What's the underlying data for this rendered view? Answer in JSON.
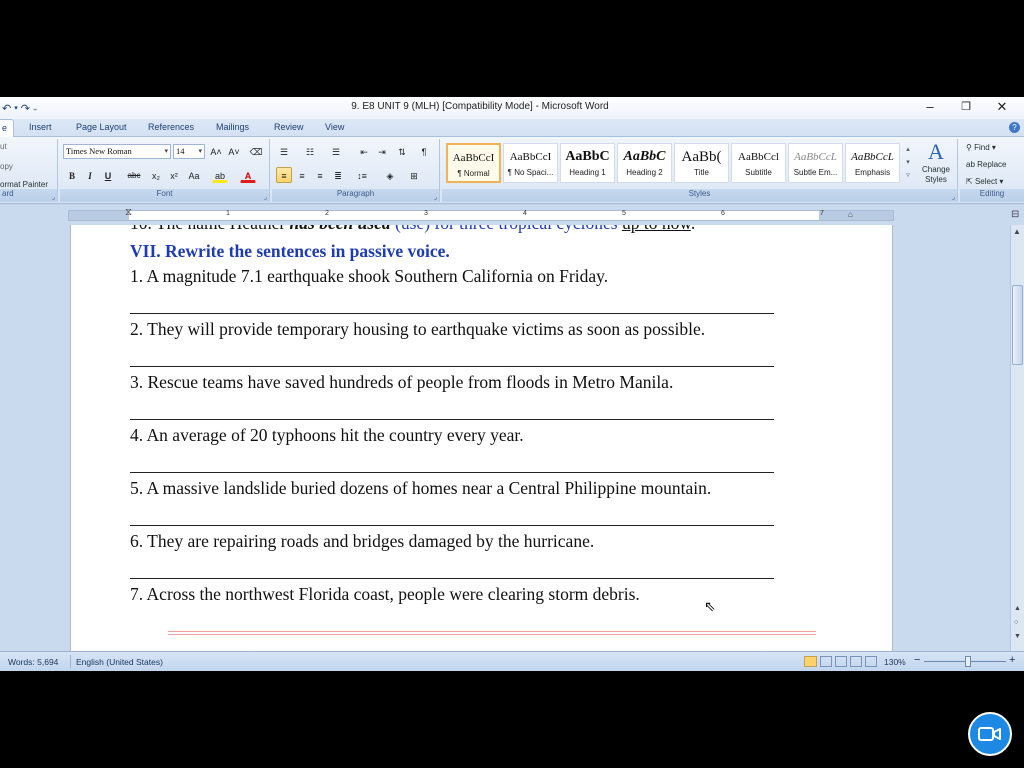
{
  "window": {
    "title": "9. E8 UNIT 9 (MLH) [Compatibility Mode] - Microsoft Word",
    "controls": {
      "minimize": "–",
      "restore": "❐",
      "close": "✕"
    }
  },
  "quick_access": {
    "undo": "↶",
    "redo": "↷"
  },
  "tabs": [
    {
      "label": "e",
      "active": true
    },
    {
      "label": "Insert"
    },
    {
      "label": "Page Layout"
    },
    {
      "label": "References"
    },
    {
      "label": "Mailings"
    },
    {
      "label": "Review"
    },
    {
      "label": "View"
    }
  ],
  "ribbon": {
    "clipboard": {
      "cut": "ut",
      "copy": "opy",
      "format_painter": "ormat Painter",
      "label": "ard"
    },
    "font": {
      "name": "Times New Roman",
      "size": "14",
      "label": "Font",
      "grow": "A˄",
      "shrink": "A˅",
      "bold": "B",
      "italic": "I",
      "underline": "U",
      "strike": "abc",
      "subscript": "x₂",
      "superscript": "x²",
      "case": "Aa",
      "highlight": "ab",
      "font_color": "A"
    },
    "paragraph": {
      "label": "Paragraph",
      "show_marks": "¶"
    },
    "styles": {
      "label": "Styles",
      "items": [
        {
          "preview": "AaBbCcI",
          "name": "¶ Normal",
          "selected": true
        },
        {
          "preview": "AaBbCcI",
          "name": "¶ No Spaci..."
        },
        {
          "preview": "AaBbC",
          "name": "Heading 1"
        },
        {
          "preview": "AaBbC",
          "name": "Heading 2"
        },
        {
          "preview": "AaBb(",
          "name": "Title"
        },
        {
          "preview": "AaBbCcl",
          "name": "Subtitle"
        },
        {
          "preview": "AaBbCcL",
          "name": "Subtle Em..."
        },
        {
          "preview": "AaBbCcL",
          "name": "Emphasis"
        }
      ],
      "change_styles": "Change Styles"
    },
    "editing": {
      "label": "Editing",
      "find": "Find",
      "replace": "Replace",
      "select": "Select"
    }
  },
  "ruler": {
    "numbers": [
      "1",
      "2",
      "3",
      "4",
      "5",
      "6",
      "7"
    ]
  },
  "document": {
    "partial_line": {
      "a": "10. The name Heather ",
      "b": "has been used",
      "c": " (use) for three tropical cyclones ",
      "d": "up to now",
      "e": "."
    },
    "heading": "VII. Rewrite the sentences in passive voice.",
    "sentences": [
      "1. A magnitude 7.1 earthquake shook Southern California on Friday.",
      "2. They will provide temporary housing to earthquake victims as soon as possible.",
      "3. Rescue teams have saved hundreds of people from floods in Metro Manila.",
      "4. An average of 20 typhoons hit the country every year.",
      "5. A massive landslide buried dozens of homes near a Central Philippine mountain.",
      "6. They are repairing roads and bridges damaged by the hurricane.",
      "7. Across the northwest Florida coast, people were clearing storm debris."
    ]
  },
  "status": {
    "words": "Words: 5,694",
    "language": "English (United States)",
    "zoom": "130%",
    "zoom_minus": "−",
    "zoom_plus": "+"
  },
  "colors": {
    "heading": "#1d3bb3",
    "ribbon": "#dfe9f5",
    "camera": "#1e88e5"
  },
  "icons": {
    "camera": "video-camera-icon"
  }
}
